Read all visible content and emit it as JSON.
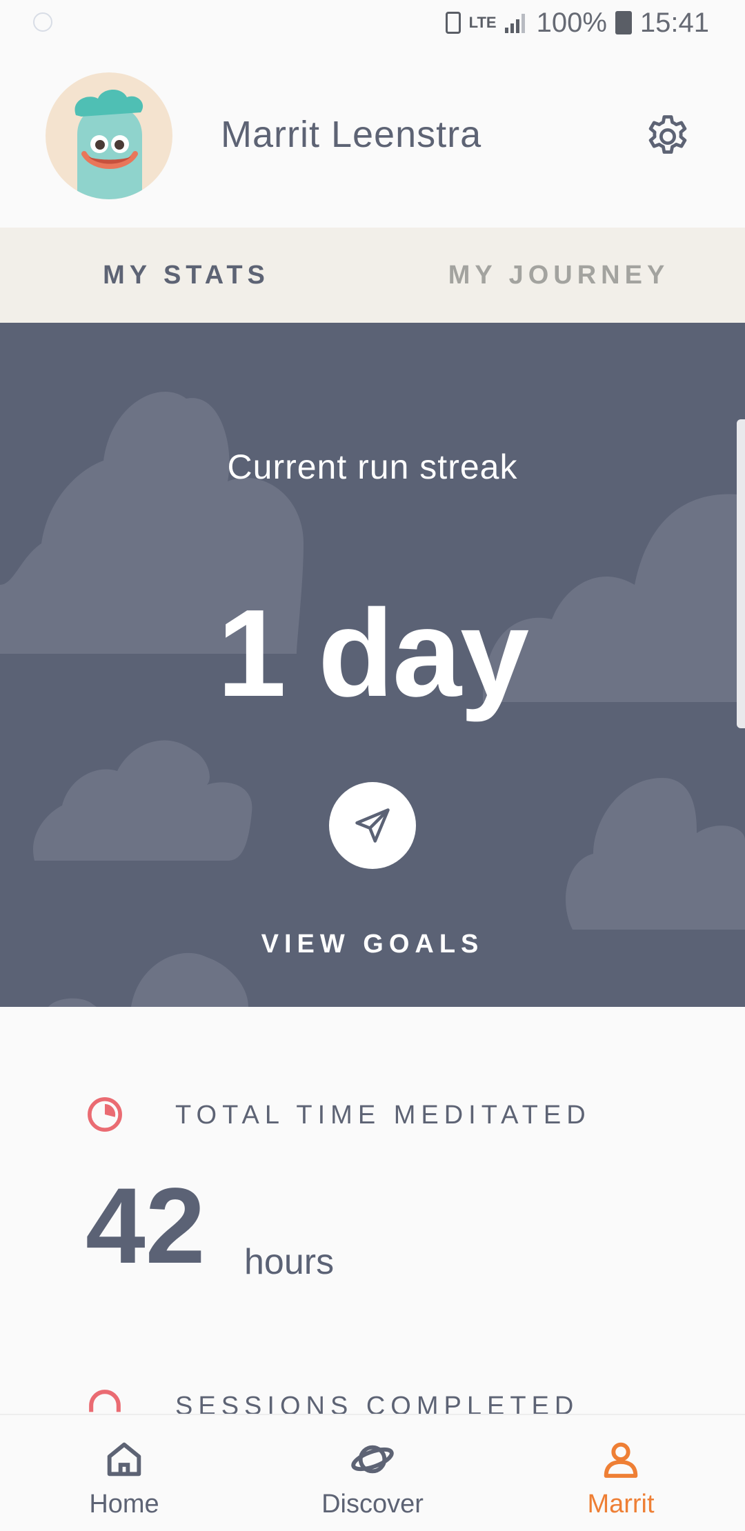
{
  "status_bar": {
    "network": "LTE",
    "battery": "100%",
    "time": "15:41"
  },
  "profile": {
    "name": "Marrit Leenstra",
    "avatar_icon": "green-creature-avatar",
    "settings_icon": "gear-icon"
  },
  "tabs": [
    {
      "label": "MY STATS",
      "active": true
    },
    {
      "label": "MY JOURNEY",
      "active": false
    }
  ],
  "streak": {
    "label": "Current run streak",
    "value": "1 day",
    "goals_icon": "paper-plane-icon",
    "goals_label": "VIEW GOALS"
  },
  "stats": [
    {
      "title": "TOTAL TIME MEDITATED",
      "value": "42",
      "unit": "hours",
      "icon": "pie-clock-icon"
    },
    {
      "title": "SESSIONS COMPLETED",
      "icon": "headphones-icon"
    }
  ],
  "nav": [
    {
      "label": "Home",
      "icon": "home-icon",
      "active": false
    },
    {
      "label": "Discover",
      "icon": "planet-icon",
      "active": false
    },
    {
      "label": "Marrit",
      "icon": "person-icon",
      "active": true
    }
  ],
  "colors": {
    "accent": "#ee7f35",
    "card": "#5b6275",
    "stat_icon": "#ea6b72",
    "text": "#5d6374"
  }
}
